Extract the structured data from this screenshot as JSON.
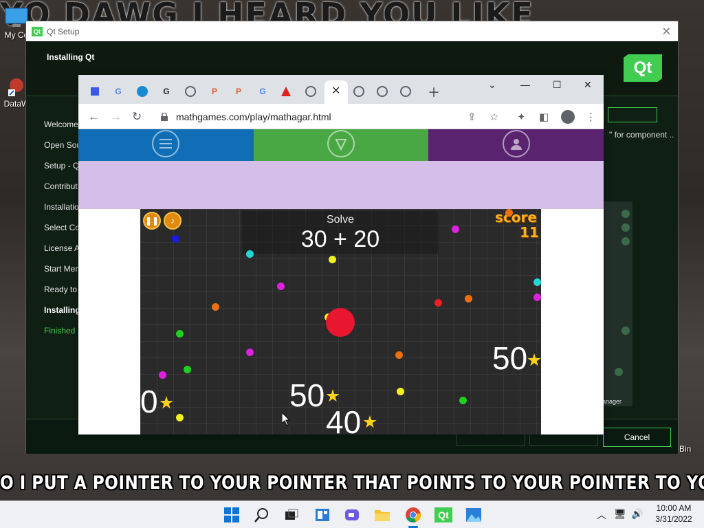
{
  "desktop": {
    "meme_top": "YO DAWG I HEARD YOU LIKE",
    "meme_bottom": "O I PUT A POINTER TO YOUR POINTER THAT POINTS TO YOUR POINTER TO YOU SO YOU CA",
    "icons": [
      {
        "label": "My Co"
      },
      {
        "label": "DataW"
      }
    ],
    "recycle_label": "Bin"
  },
  "qt": {
    "window_title": "Qt Setup",
    "heading": "Installing Qt",
    "logo": "Qt",
    "steps": [
      {
        "label": "Welcome"
      },
      {
        "label": "Open Sou"
      },
      {
        "label": "Setup - Q"
      },
      {
        "label": "Contribut"
      },
      {
        "label": "Installatio"
      },
      {
        "label": "Select Co"
      },
      {
        "label": "License A"
      },
      {
        "label": "Start Men"
      },
      {
        "label": "Ready to I"
      },
      {
        "label": "Installing"
      },
      {
        "label": "Finished"
      }
    ],
    "component_text": "\" for component ..",
    "manager_text": "anager",
    "cancel_label": "Cancel"
  },
  "browser": {
    "url": "mathgames.com/play/mathagar.html",
    "tabs": [
      {
        "icon": "square-icon"
      },
      {
        "icon": "google-icon"
      },
      {
        "icon": "site-icon"
      },
      {
        "icon": "google-plus-icon"
      },
      {
        "icon": "chrome-icon"
      },
      {
        "icon": "pear-icon"
      },
      {
        "icon": "pear-icon"
      },
      {
        "icon": "google-icon"
      },
      {
        "icon": "adobe-icon"
      },
      {
        "icon": "chrome-icon"
      },
      {
        "icon": "close-icon"
      },
      {
        "icon": "chrome-icon"
      },
      {
        "icon": "chrome-icon"
      },
      {
        "icon": "chrome-icon"
      }
    ],
    "nav_colors": [
      "#0f6eb5",
      "#4aa844",
      "#5a2370"
    ],
    "ad_color": "#d5bfe8"
  },
  "game": {
    "question_label": "Solve",
    "expression": "30 + 20",
    "score_label": "score",
    "score_value": "11",
    "orbs": [
      {
        "value": "0"
      },
      {
        "value": "50"
      },
      {
        "value": "40"
      },
      {
        "value": "50"
      }
    ]
  },
  "taskbar": {
    "time": "10:00 AM",
    "date": "3/31/2022",
    "qt_label": "Qt"
  }
}
